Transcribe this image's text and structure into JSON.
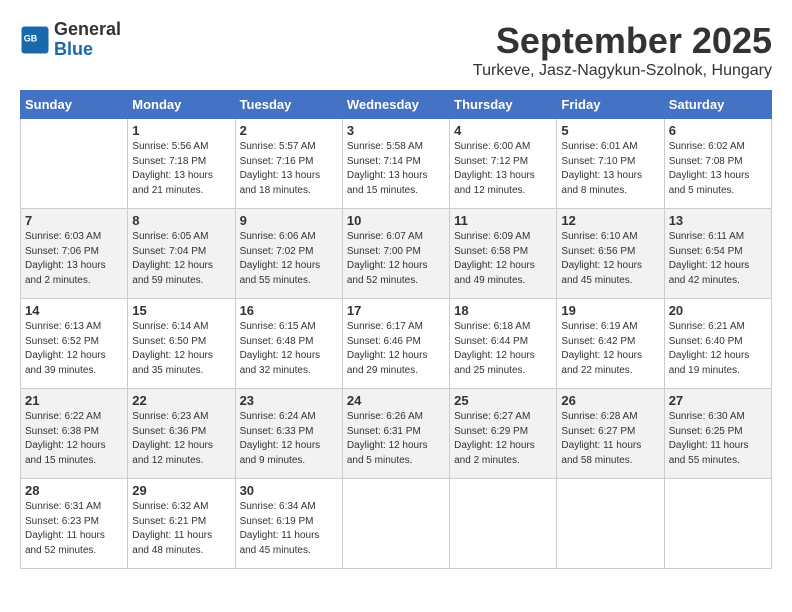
{
  "header": {
    "logo_line1": "General",
    "logo_line2": "Blue",
    "title": "September 2025",
    "subtitle": "Turkeve, Jasz-Nagykun-Szolnok, Hungary"
  },
  "days_of_week": [
    "Sunday",
    "Monday",
    "Tuesday",
    "Wednesday",
    "Thursday",
    "Friday",
    "Saturday"
  ],
  "weeks": [
    [
      {
        "day": "",
        "info": ""
      },
      {
        "day": "1",
        "info": "Sunrise: 5:56 AM\nSunset: 7:18 PM\nDaylight: 13 hours\nand 21 minutes."
      },
      {
        "day": "2",
        "info": "Sunrise: 5:57 AM\nSunset: 7:16 PM\nDaylight: 13 hours\nand 18 minutes."
      },
      {
        "day": "3",
        "info": "Sunrise: 5:58 AM\nSunset: 7:14 PM\nDaylight: 13 hours\nand 15 minutes."
      },
      {
        "day": "4",
        "info": "Sunrise: 6:00 AM\nSunset: 7:12 PM\nDaylight: 13 hours\nand 12 minutes."
      },
      {
        "day": "5",
        "info": "Sunrise: 6:01 AM\nSunset: 7:10 PM\nDaylight: 13 hours\nand 8 minutes."
      },
      {
        "day": "6",
        "info": "Sunrise: 6:02 AM\nSunset: 7:08 PM\nDaylight: 13 hours\nand 5 minutes."
      }
    ],
    [
      {
        "day": "7",
        "info": "Sunrise: 6:03 AM\nSunset: 7:06 PM\nDaylight: 13 hours\nand 2 minutes."
      },
      {
        "day": "8",
        "info": "Sunrise: 6:05 AM\nSunset: 7:04 PM\nDaylight: 12 hours\nand 59 minutes."
      },
      {
        "day": "9",
        "info": "Sunrise: 6:06 AM\nSunset: 7:02 PM\nDaylight: 12 hours\nand 55 minutes."
      },
      {
        "day": "10",
        "info": "Sunrise: 6:07 AM\nSunset: 7:00 PM\nDaylight: 12 hours\nand 52 minutes."
      },
      {
        "day": "11",
        "info": "Sunrise: 6:09 AM\nSunset: 6:58 PM\nDaylight: 12 hours\nand 49 minutes."
      },
      {
        "day": "12",
        "info": "Sunrise: 6:10 AM\nSunset: 6:56 PM\nDaylight: 12 hours\nand 45 minutes."
      },
      {
        "day": "13",
        "info": "Sunrise: 6:11 AM\nSunset: 6:54 PM\nDaylight: 12 hours\nand 42 minutes."
      }
    ],
    [
      {
        "day": "14",
        "info": "Sunrise: 6:13 AM\nSunset: 6:52 PM\nDaylight: 12 hours\nand 39 minutes."
      },
      {
        "day": "15",
        "info": "Sunrise: 6:14 AM\nSunset: 6:50 PM\nDaylight: 12 hours\nand 35 minutes."
      },
      {
        "day": "16",
        "info": "Sunrise: 6:15 AM\nSunset: 6:48 PM\nDaylight: 12 hours\nand 32 minutes."
      },
      {
        "day": "17",
        "info": "Sunrise: 6:17 AM\nSunset: 6:46 PM\nDaylight: 12 hours\nand 29 minutes."
      },
      {
        "day": "18",
        "info": "Sunrise: 6:18 AM\nSunset: 6:44 PM\nDaylight: 12 hours\nand 25 minutes."
      },
      {
        "day": "19",
        "info": "Sunrise: 6:19 AM\nSunset: 6:42 PM\nDaylight: 12 hours\nand 22 minutes."
      },
      {
        "day": "20",
        "info": "Sunrise: 6:21 AM\nSunset: 6:40 PM\nDaylight: 12 hours\nand 19 minutes."
      }
    ],
    [
      {
        "day": "21",
        "info": "Sunrise: 6:22 AM\nSunset: 6:38 PM\nDaylight: 12 hours\nand 15 minutes."
      },
      {
        "day": "22",
        "info": "Sunrise: 6:23 AM\nSunset: 6:36 PM\nDaylight: 12 hours\nand 12 minutes."
      },
      {
        "day": "23",
        "info": "Sunrise: 6:24 AM\nSunset: 6:33 PM\nDaylight: 12 hours\nand 9 minutes."
      },
      {
        "day": "24",
        "info": "Sunrise: 6:26 AM\nSunset: 6:31 PM\nDaylight: 12 hours\nand 5 minutes."
      },
      {
        "day": "25",
        "info": "Sunrise: 6:27 AM\nSunset: 6:29 PM\nDaylight: 12 hours\nand 2 minutes."
      },
      {
        "day": "26",
        "info": "Sunrise: 6:28 AM\nSunset: 6:27 PM\nDaylight: 11 hours\nand 58 minutes."
      },
      {
        "day": "27",
        "info": "Sunrise: 6:30 AM\nSunset: 6:25 PM\nDaylight: 11 hours\nand 55 minutes."
      }
    ],
    [
      {
        "day": "28",
        "info": "Sunrise: 6:31 AM\nSunset: 6:23 PM\nDaylight: 11 hours\nand 52 minutes."
      },
      {
        "day": "29",
        "info": "Sunrise: 6:32 AM\nSunset: 6:21 PM\nDaylight: 11 hours\nand 48 minutes."
      },
      {
        "day": "30",
        "info": "Sunrise: 6:34 AM\nSunset: 6:19 PM\nDaylight: 11 hours\nand 45 minutes."
      },
      {
        "day": "",
        "info": ""
      },
      {
        "day": "",
        "info": ""
      },
      {
        "day": "",
        "info": ""
      },
      {
        "day": "",
        "info": ""
      }
    ]
  ]
}
